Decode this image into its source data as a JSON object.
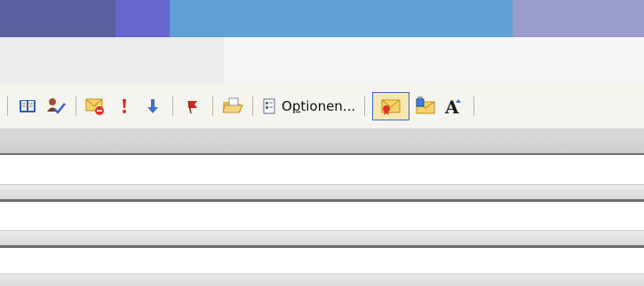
{
  "title_strip": {
    "colors": [
      "#5a5f9e",
      "#6867d0",
      "#5f9fd5",
      "#9b9ccb"
    ]
  },
  "toolbar": {
    "buttons": [
      {
        "name": "address-book-icon"
      },
      {
        "name": "check-names-icon"
      },
      {
        "name": "delete-message-icon"
      },
      {
        "name": "importance-high-icon"
      },
      {
        "name": "importance-low-icon"
      },
      {
        "name": "follow-up-flag-icon"
      },
      {
        "name": "open-folder-icon"
      }
    ],
    "options_label": "Optionen...",
    "options_icon": "options-icon",
    "right_buttons": [
      {
        "name": "sign-message-icon",
        "active": true
      },
      {
        "name": "encrypt-message-icon",
        "active": false
      },
      {
        "name": "font-size-icon",
        "active": false
      }
    ]
  },
  "accent": {
    "active_border": "#316ac5",
    "active_fill": "#f6e7b0"
  }
}
